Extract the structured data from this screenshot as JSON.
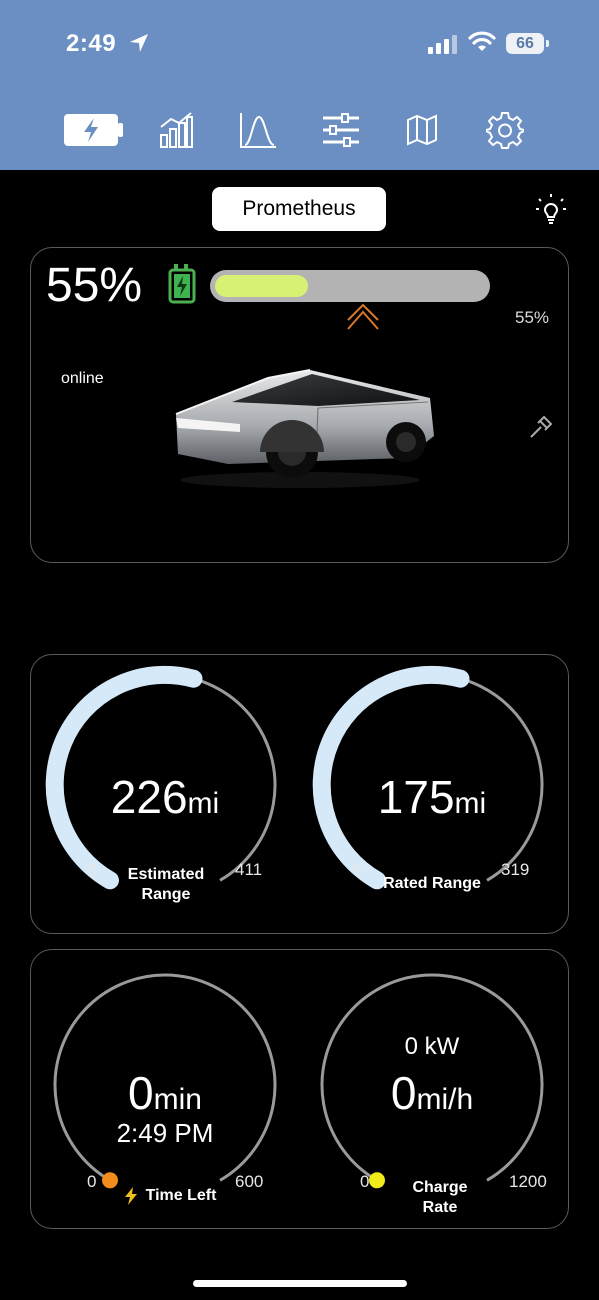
{
  "status_bar": {
    "time": "2:49",
    "battery": "66"
  },
  "tabs": [
    {
      "name": "tab-charge",
      "icon": "charge-battery-icon",
      "active": true
    },
    {
      "name": "tab-stats",
      "icon": "bar-chart-icon"
    },
    {
      "name": "tab-curve",
      "icon": "curve-chart-icon"
    },
    {
      "name": "tab-controls",
      "icon": "sliders-icon"
    },
    {
      "name": "tab-map",
      "icon": "map-icon"
    },
    {
      "name": "tab-settings",
      "icon": "gear-icon"
    }
  ],
  "vehicle": {
    "name": "Prometheus",
    "status": "online"
  },
  "battery": {
    "percent_label": "55%",
    "percent_small": "55%",
    "level": 0.55,
    "fill_color": "#d6f173"
  },
  "range": {
    "estimated": {
      "value": "226",
      "unit": "mi",
      "min": "0",
      "max": "411",
      "label_line1": "Estimated",
      "label_line2": "Range",
      "fraction": 0.55
    },
    "rated": {
      "value": "175",
      "unit": "mi",
      "min": "0",
      "max": "319",
      "label": "Rated Range",
      "fraction": 0.55
    }
  },
  "charging": {
    "time_left": {
      "value": "0",
      "unit": "min",
      "time": "2:49 PM",
      "min": "0",
      "max": "600",
      "label": "Time Left",
      "dot_color": "#f28c1c"
    },
    "charge_rate": {
      "power": "0 kW",
      "value": "0",
      "unit": "mi/h",
      "min": "0",
      "max": "1200",
      "label_line1": "Charge",
      "label_line2": "Rate",
      "dot_color": "#f0ec1a"
    }
  },
  "colors": {
    "header": "#6b8fc2",
    "arc": "#d5e9f9",
    "track": "#9a9a9a"
  }
}
